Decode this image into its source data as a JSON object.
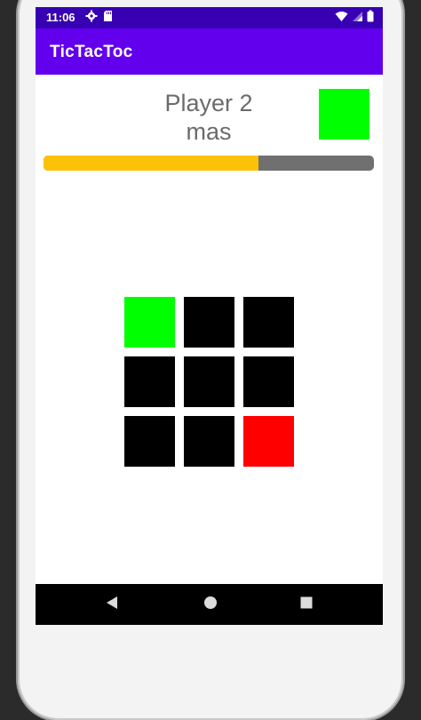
{
  "status_bar": {
    "time": "11:06",
    "icons": [
      "settings-gear-icon",
      "sd-card-icon",
      "wifi-icon",
      "signal-icon",
      "battery-icon"
    ]
  },
  "app_bar": {
    "title": "TicTacToc",
    "color": "#6200ee",
    "status_color": "#3700b3"
  },
  "game": {
    "player_label": "Player 2",
    "player_sublabel": "mas",
    "player_color": "#00ff00",
    "progress": 0.65,
    "progress_fill_color": "#ffc107",
    "progress_track_color": "#707070",
    "board": [
      [
        "#00ff00",
        "#000000",
        "#000000"
      ],
      [
        "#000000",
        "#000000",
        "#000000"
      ],
      [
        "#000000",
        "#000000",
        "#ff0000"
      ]
    ]
  },
  "nav_bar": {
    "buttons": [
      "back-icon",
      "home-icon",
      "recents-icon"
    ]
  }
}
